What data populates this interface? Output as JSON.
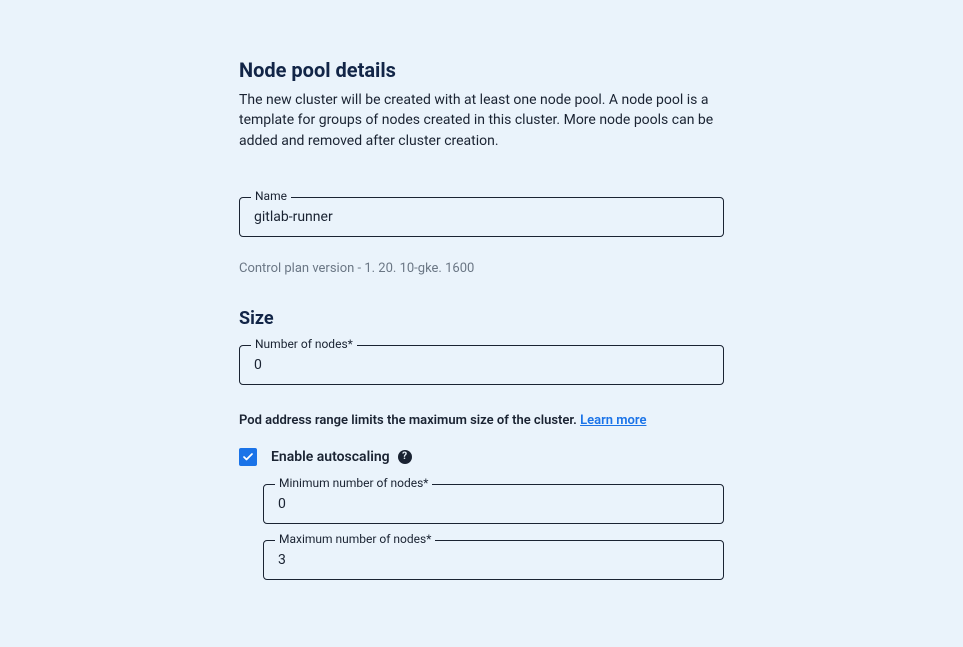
{
  "header": {
    "title": "Node pool details",
    "description": "The new cluster will be created with at least one node pool. A node pool is a template for groups of nodes created in this cluster. More node pools can be added and removed after cluster creation."
  },
  "nameField": {
    "label": "Name",
    "value": "gitlab-runner"
  },
  "versionText": "Control plan version - 1. 20. 10-gke. 1600",
  "sizeSection": {
    "title": "Size",
    "numberOfNodes": {
      "label": "Number of nodes*",
      "value": "0"
    }
  },
  "podInfo": {
    "text": "Pod address range limits the maximum size of the cluster. ",
    "linkText": "Learn more"
  },
  "autoscaling": {
    "checkboxLabel": "Enable autoscaling",
    "checked": true,
    "minNodes": {
      "label": "Minimum number of nodes*",
      "value": "0"
    },
    "maxNodes": {
      "label": "Maximum number of nodes*",
      "value": "3"
    }
  }
}
